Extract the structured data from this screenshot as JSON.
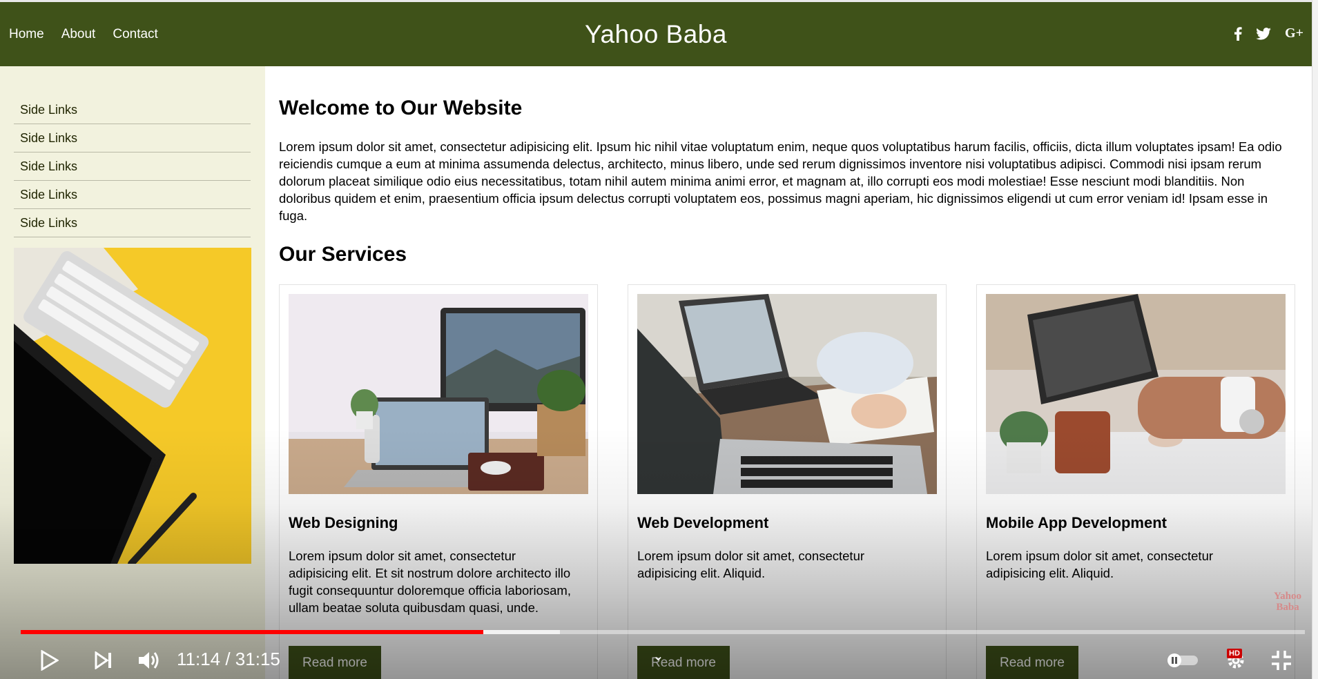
{
  "header": {
    "nav": [
      "Home",
      "About",
      "Contact"
    ],
    "brand": "Yahoo Baba",
    "social_icons": [
      "facebook-icon",
      "twitter-icon",
      "google-plus-icon"
    ]
  },
  "sidebar": {
    "links": [
      "Side Links",
      "Side Links",
      "Side Links",
      "Side Links",
      "Side Links"
    ]
  },
  "main": {
    "title": "Welcome to Our Website",
    "paragraph": "Lorem ipsum dolor sit amet, consectetur adipisicing elit. Ipsum hic nihil vitae voluptatum enim, neque quos voluptatibus harum facilis, officiis, dicta illum voluptates ipsam! Ea odio reiciendis cumque a eum at minima assumenda delectus, architecto, minus libero, unde sed rerum dignissimos inventore nisi voluptatibus adipisci. Commodi nisi ipsam rerum dolorum placeat similique odio eius necessitatibus, totam nihil autem minima animi error, et magnam at, illo corrupti eos modi molestiae! Esse nesciunt modi blanditiis. Non doloribus quidem et enim, praesentium officia ipsum delectus corrupti voluptatem eos, possimus magni aperiam, hic dignissimos eligendi ut cum error veniam id! Ipsam esse in fuga.",
    "services_title": "Our Services",
    "cards": [
      {
        "title": "Web Designing",
        "text": "Lorem ipsum dolor sit amet, consectetur adipisicing elit. Et sit nostrum dolore architecto illo fugit consequuntur doloremque officia laboriosam, ullam beatae soluta quibusdam quasi, unde.",
        "button": "Read more"
      },
      {
        "title": "Web Development",
        "text": "Lorem ipsum dolor sit amet, consectetur adipisicing elit. Aliquid.",
        "button": "Read more"
      },
      {
        "title": "Mobile App Development",
        "text": "Lorem ipsum dolor sit amet, consectetur adipisicing elit. Aliquid.",
        "button": "Read more"
      }
    ]
  },
  "player": {
    "time": "11:14 / 31:15",
    "progress_played": 0.36,
    "progress_buffered": 0.42,
    "watermark": "Yahoo Baba",
    "hd_badge": "HD",
    "colors": {
      "played": "#ff0000",
      "header": "#3f5219",
      "sidebar": "#f2f2de"
    }
  }
}
